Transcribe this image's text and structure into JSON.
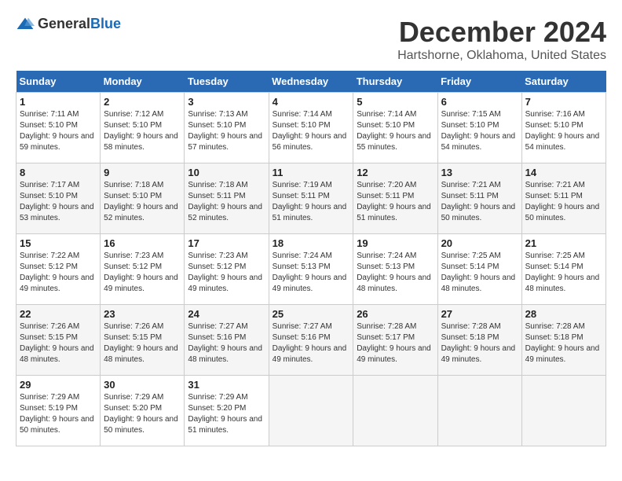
{
  "header": {
    "logo_general": "General",
    "logo_blue": "Blue",
    "month_title": "December 2024",
    "location": "Hartshorne, Oklahoma, United States"
  },
  "weekdays": [
    "Sunday",
    "Monday",
    "Tuesday",
    "Wednesday",
    "Thursday",
    "Friday",
    "Saturday"
  ],
  "weeks": [
    [
      {
        "day": "1",
        "sunrise": "7:11 AM",
        "sunset": "5:10 PM",
        "daylight": "9 hours and 59 minutes."
      },
      {
        "day": "2",
        "sunrise": "7:12 AM",
        "sunset": "5:10 PM",
        "daylight": "9 hours and 58 minutes."
      },
      {
        "day": "3",
        "sunrise": "7:13 AM",
        "sunset": "5:10 PM",
        "daylight": "9 hours and 57 minutes."
      },
      {
        "day": "4",
        "sunrise": "7:14 AM",
        "sunset": "5:10 PM",
        "daylight": "9 hours and 56 minutes."
      },
      {
        "day": "5",
        "sunrise": "7:14 AM",
        "sunset": "5:10 PM",
        "daylight": "9 hours and 55 minutes."
      },
      {
        "day": "6",
        "sunrise": "7:15 AM",
        "sunset": "5:10 PM",
        "daylight": "9 hours and 54 minutes."
      },
      {
        "day": "7",
        "sunrise": "7:16 AM",
        "sunset": "5:10 PM",
        "daylight": "9 hours and 54 minutes."
      }
    ],
    [
      {
        "day": "8",
        "sunrise": "7:17 AM",
        "sunset": "5:10 PM",
        "daylight": "9 hours and 53 minutes."
      },
      {
        "day": "9",
        "sunrise": "7:18 AM",
        "sunset": "5:10 PM",
        "daylight": "9 hours and 52 minutes."
      },
      {
        "day": "10",
        "sunrise": "7:18 AM",
        "sunset": "5:11 PM",
        "daylight": "9 hours and 52 minutes."
      },
      {
        "day": "11",
        "sunrise": "7:19 AM",
        "sunset": "5:11 PM",
        "daylight": "9 hours and 51 minutes."
      },
      {
        "day": "12",
        "sunrise": "7:20 AM",
        "sunset": "5:11 PM",
        "daylight": "9 hours and 51 minutes."
      },
      {
        "day": "13",
        "sunrise": "7:21 AM",
        "sunset": "5:11 PM",
        "daylight": "9 hours and 50 minutes."
      },
      {
        "day": "14",
        "sunrise": "7:21 AM",
        "sunset": "5:11 PM",
        "daylight": "9 hours and 50 minutes."
      }
    ],
    [
      {
        "day": "15",
        "sunrise": "7:22 AM",
        "sunset": "5:12 PM",
        "daylight": "9 hours and 49 minutes."
      },
      {
        "day": "16",
        "sunrise": "7:23 AM",
        "sunset": "5:12 PM",
        "daylight": "9 hours and 49 minutes."
      },
      {
        "day": "17",
        "sunrise": "7:23 AM",
        "sunset": "5:12 PM",
        "daylight": "9 hours and 49 minutes."
      },
      {
        "day": "18",
        "sunrise": "7:24 AM",
        "sunset": "5:13 PM",
        "daylight": "9 hours and 49 minutes."
      },
      {
        "day": "19",
        "sunrise": "7:24 AM",
        "sunset": "5:13 PM",
        "daylight": "9 hours and 48 minutes."
      },
      {
        "day": "20",
        "sunrise": "7:25 AM",
        "sunset": "5:14 PM",
        "daylight": "9 hours and 48 minutes."
      },
      {
        "day": "21",
        "sunrise": "7:25 AM",
        "sunset": "5:14 PM",
        "daylight": "9 hours and 48 minutes."
      }
    ],
    [
      {
        "day": "22",
        "sunrise": "7:26 AM",
        "sunset": "5:15 PM",
        "daylight": "9 hours and 48 minutes."
      },
      {
        "day": "23",
        "sunrise": "7:26 AM",
        "sunset": "5:15 PM",
        "daylight": "9 hours and 48 minutes."
      },
      {
        "day": "24",
        "sunrise": "7:27 AM",
        "sunset": "5:16 PM",
        "daylight": "9 hours and 48 minutes."
      },
      {
        "day": "25",
        "sunrise": "7:27 AM",
        "sunset": "5:16 PM",
        "daylight": "9 hours and 49 minutes."
      },
      {
        "day": "26",
        "sunrise": "7:28 AM",
        "sunset": "5:17 PM",
        "daylight": "9 hours and 49 minutes."
      },
      {
        "day": "27",
        "sunrise": "7:28 AM",
        "sunset": "5:18 PM",
        "daylight": "9 hours and 49 minutes."
      },
      {
        "day": "28",
        "sunrise": "7:28 AM",
        "sunset": "5:18 PM",
        "daylight": "9 hours and 49 minutes."
      }
    ],
    [
      {
        "day": "29",
        "sunrise": "7:29 AM",
        "sunset": "5:19 PM",
        "daylight": "9 hours and 50 minutes."
      },
      {
        "day": "30",
        "sunrise": "7:29 AM",
        "sunset": "5:20 PM",
        "daylight": "9 hours and 50 minutes."
      },
      {
        "day": "31",
        "sunrise": "7:29 AM",
        "sunset": "5:20 PM",
        "daylight": "9 hours and 51 minutes."
      },
      null,
      null,
      null,
      null
    ]
  ]
}
